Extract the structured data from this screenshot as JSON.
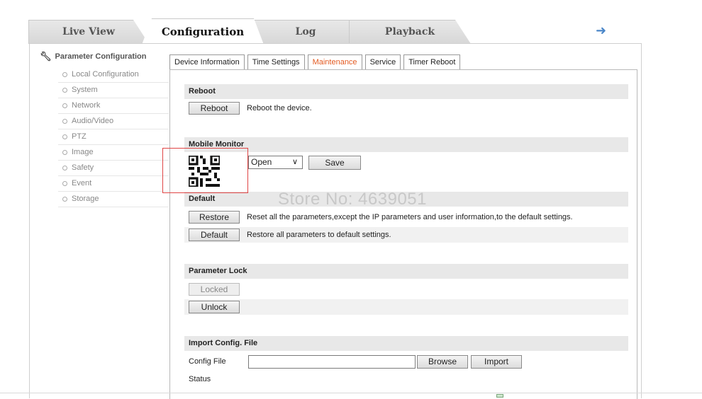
{
  "tabs": [
    {
      "label": "Live View"
    },
    {
      "label": "Configuration",
      "active": true
    },
    {
      "label": "Log"
    },
    {
      "label": "Playback"
    }
  ],
  "logout_icon": "arrow-right-icon",
  "nav": {
    "header": "Parameter Configuration",
    "items": [
      "Local Configuration",
      "System",
      "Network",
      "Audio/Video",
      "PTZ",
      "Image",
      "Safety",
      "Event",
      "Storage"
    ]
  },
  "subtabs": [
    "Device Information",
    "Time Settings",
    "Maintenance",
    "Service",
    "Timer Reboot"
  ],
  "active_subtab": "Maintenance",
  "reboot": {
    "title": "Reboot",
    "button": "Reboot",
    "desc": "Reboot the device."
  },
  "mobile_monitor": {
    "title": "Mobile Monitor",
    "select_value": "Open",
    "save_button": "Save"
  },
  "default": {
    "title": "Default",
    "restore_button": "Restore",
    "restore_desc": "Reset all the parameters,except the IP parameters and user information,to the default settings.",
    "default_button": "Default",
    "default_desc": "Restore all parameters to default settings."
  },
  "parameter_lock": {
    "title": "Parameter Lock",
    "locked_button": "Locked",
    "unlock_button": "Unlock"
  },
  "import_config": {
    "title": "Import Config. File",
    "config_file_label": "Config File",
    "browse_button": "Browse",
    "import_button": "Import",
    "status_label": "Status"
  },
  "watermark": "Store No: 4639051",
  "colors": {
    "active_subtab": "#e35a21",
    "highlight_box": "#e04545",
    "logout_arrow": "#4a86c8"
  }
}
